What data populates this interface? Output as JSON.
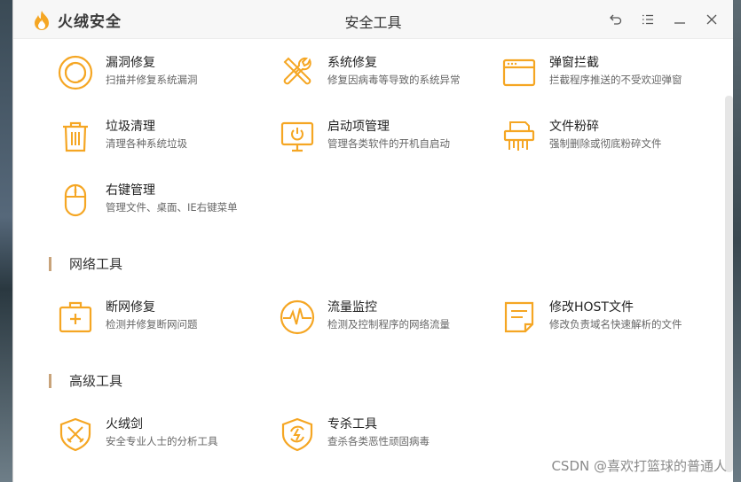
{
  "app": {
    "brand": "火绒安全",
    "window_title": "安全工具"
  },
  "colors": {
    "accent": "#f5a623",
    "section_bar": "#c8a37a"
  },
  "window_controls": [
    {
      "name": "back-icon"
    },
    {
      "name": "menu-icon"
    },
    {
      "name": "minimize-icon"
    },
    {
      "name": "close-icon"
    }
  ],
  "system_tools": [
    {
      "name": "漏洞修复",
      "desc": "扫描并修复系统漏洞",
      "icon": "vulnerability-fix-icon"
    },
    {
      "name": "系统修复",
      "desc": "修复因病毒等导致的系统异常",
      "icon": "system-repair-icon"
    },
    {
      "name": "弹窗拦截",
      "desc": "拦截程序推送的不受欢迎弹窗",
      "icon": "popup-block-icon"
    },
    {
      "name": "垃圾清理",
      "desc": "清理各种系统垃圾",
      "icon": "trash-icon"
    },
    {
      "name": "启动项管理",
      "desc": "管理各类软件的开机自启动",
      "icon": "startup-manager-icon"
    },
    {
      "name": "文件粉碎",
      "desc": "强制删除或彻底粉碎文件",
      "icon": "shredder-icon"
    },
    {
      "name": "右键管理",
      "desc": "管理文件、桌面、IE右键菜单",
      "icon": "mouse-icon"
    }
  ],
  "network_section": {
    "title": "网络工具",
    "tools": [
      {
        "name": "断网修复",
        "desc": "检测并修复断网问题",
        "icon": "network-repair-icon"
      },
      {
        "name": "流量监控",
        "desc": "检测及控制程序的网络流量",
        "icon": "traffic-monitor-icon"
      },
      {
        "name": "修改HOST文件",
        "desc": "修改负责域名快速解析的文件",
        "icon": "host-file-icon"
      }
    ]
  },
  "advanced_section": {
    "title": "高级工具",
    "tools": [
      {
        "name": "火绒剑",
        "desc": "安全专业人士的分析工具",
        "icon": "sword-shield-icon"
      },
      {
        "name": "专杀工具",
        "desc": "查杀各类恶性顽固病毒",
        "icon": "antivirus-shield-icon"
      }
    ]
  },
  "watermark": "CSDN @喜欢打篮球的普通人"
}
